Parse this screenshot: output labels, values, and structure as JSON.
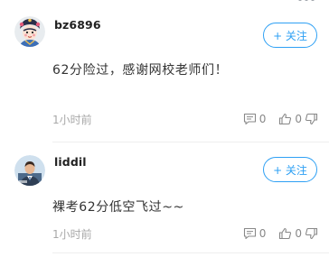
{
  "colors": {
    "accent": "#2ea0f4",
    "text_primary": "#222222",
    "text_body": "#333333",
    "text_muted": "#a8a8a8",
    "divider": "#eeeeee"
  },
  "comments": [
    {
      "username": "bz6896",
      "avatar_icon": "cartoon-avatar-icon",
      "follow_label": "+ 关注",
      "text": "62分险过，感谢网校老师们！",
      "time": "1小时前",
      "reply_count": "0",
      "like_count": "0"
    },
    {
      "username": "liddil",
      "avatar_icon": "person-avatar-icon",
      "follow_label": "+ 关注",
      "text": "裸考62分低空飞过~~",
      "time": "1小时前",
      "reply_count": "0",
      "like_count": "0"
    }
  ]
}
